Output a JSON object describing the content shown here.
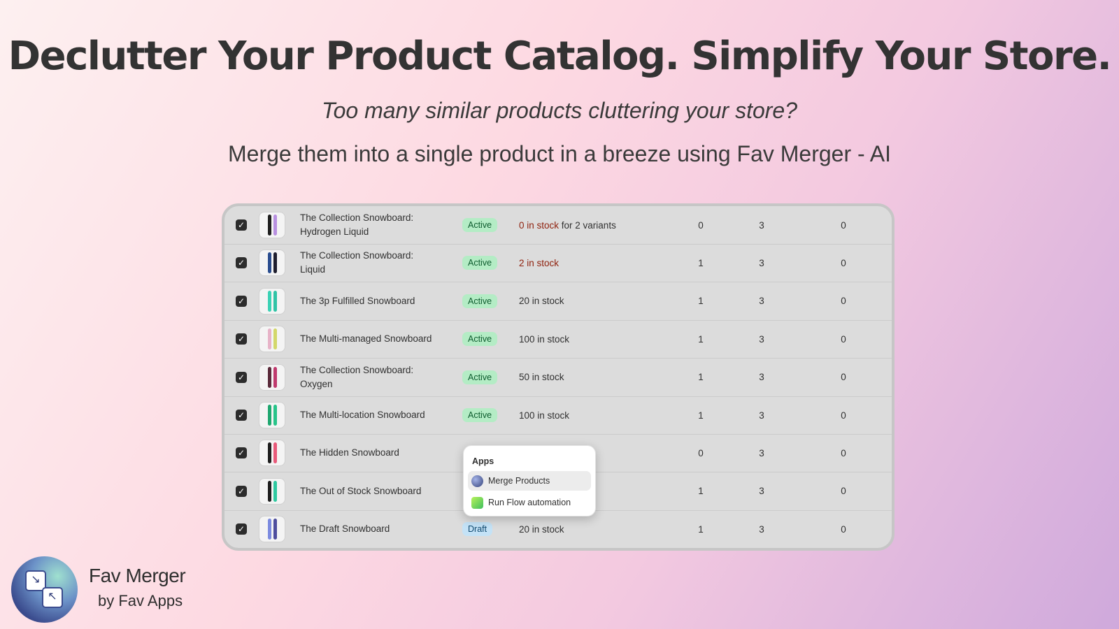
{
  "hero": {
    "headline": "Declutter Your Product Catalog. Simplify Your Store.",
    "subtitle": "Too many similar products cluttering your store?",
    "tagline": "Merge them into a single product in a breeze using Fav Merger - AI"
  },
  "products": [
    {
      "name": "The Collection Snowboard: Hydrogen Liquid",
      "status": "Active",
      "stock_warn": "0 in stock",
      "stock_rest": " for 2 variants",
      "c1": "0",
      "c2": "3",
      "c3": "0",
      "colors": [
        "#1e1e1e",
        "#b890e0"
      ]
    },
    {
      "name": "The Collection Snowboard: Liquid",
      "status": "Active",
      "stock_warn": "2 in stock",
      "stock_rest": "",
      "c1": "1",
      "c2": "3",
      "c3": "0",
      "colors": [
        "#2a4d8f",
        "#1e1e2e"
      ]
    },
    {
      "name": "The 3p Fulfilled Snowboard",
      "status": "Active",
      "stock_warn": "",
      "stock_rest": "20 in stock",
      "c1": "1",
      "c2": "3",
      "c3": "0",
      "colors": [
        "#3bd2b5",
        "#2fc4a6"
      ]
    },
    {
      "name": "The Multi-managed Snowboard",
      "status": "Active",
      "stock_warn": "",
      "stock_rest": "100 in stock",
      "c1": "1",
      "c2": "3",
      "c3": "0",
      "colors": [
        "#e7b3c8",
        "#d3d76a"
      ]
    },
    {
      "name": "The Collection Snowboard: Oxygen",
      "status": "Active",
      "stock_warn": "",
      "stock_rest": "50 in stock",
      "c1": "1",
      "c2": "3",
      "c3": "0",
      "colors": [
        "#5a2a3a",
        "#c03a6e"
      ]
    },
    {
      "name": "The Multi-location Snowboard",
      "status": "Active",
      "stock_warn": "",
      "stock_rest": "100 in stock",
      "c1": "1",
      "c2": "3",
      "c3": "0",
      "colors": [
        "#1fa770",
        "#27c489"
      ]
    },
    {
      "name": "The Hidden Snowboard",
      "status": "",
      "stock_warn": "",
      "stock_rest": "",
      "c1": "0",
      "c2": "3",
      "c3": "0",
      "colors": [
        "#1e1e1e",
        "#e85a7a"
      ]
    },
    {
      "name": "The Out of Stock Snowboard",
      "status": "",
      "stock_warn": "",
      "stock_rest": "",
      "c1": "1",
      "c2": "3",
      "c3": "0",
      "colors": [
        "#1e1e1e",
        "#2ec9a0"
      ]
    },
    {
      "name": "The Draft Snowboard",
      "status": "Draft",
      "stock_warn": "",
      "stock_rest": "20 in stock",
      "c1": "1",
      "c2": "3",
      "c3": "0",
      "colors": [
        "#7c8be0",
        "#4e4e9e"
      ]
    }
  ],
  "popup": {
    "title": "Apps",
    "items": [
      {
        "label": "Merge Products",
        "icon": "merge-products-icon"
      },
      {
        "label": "Run Flow automation",
        "icon": "flow-icon"
      }
    ]
  },
  "brand": {
    "name": "Fav Merger",
    "by": "by Fav Apps"
  },
  "colors": {
    "active_badge": "#b4ecc5",
    "draft_badge": "#c4e2f6",
    "warning_text": "#8e1f0b"
  }
}
